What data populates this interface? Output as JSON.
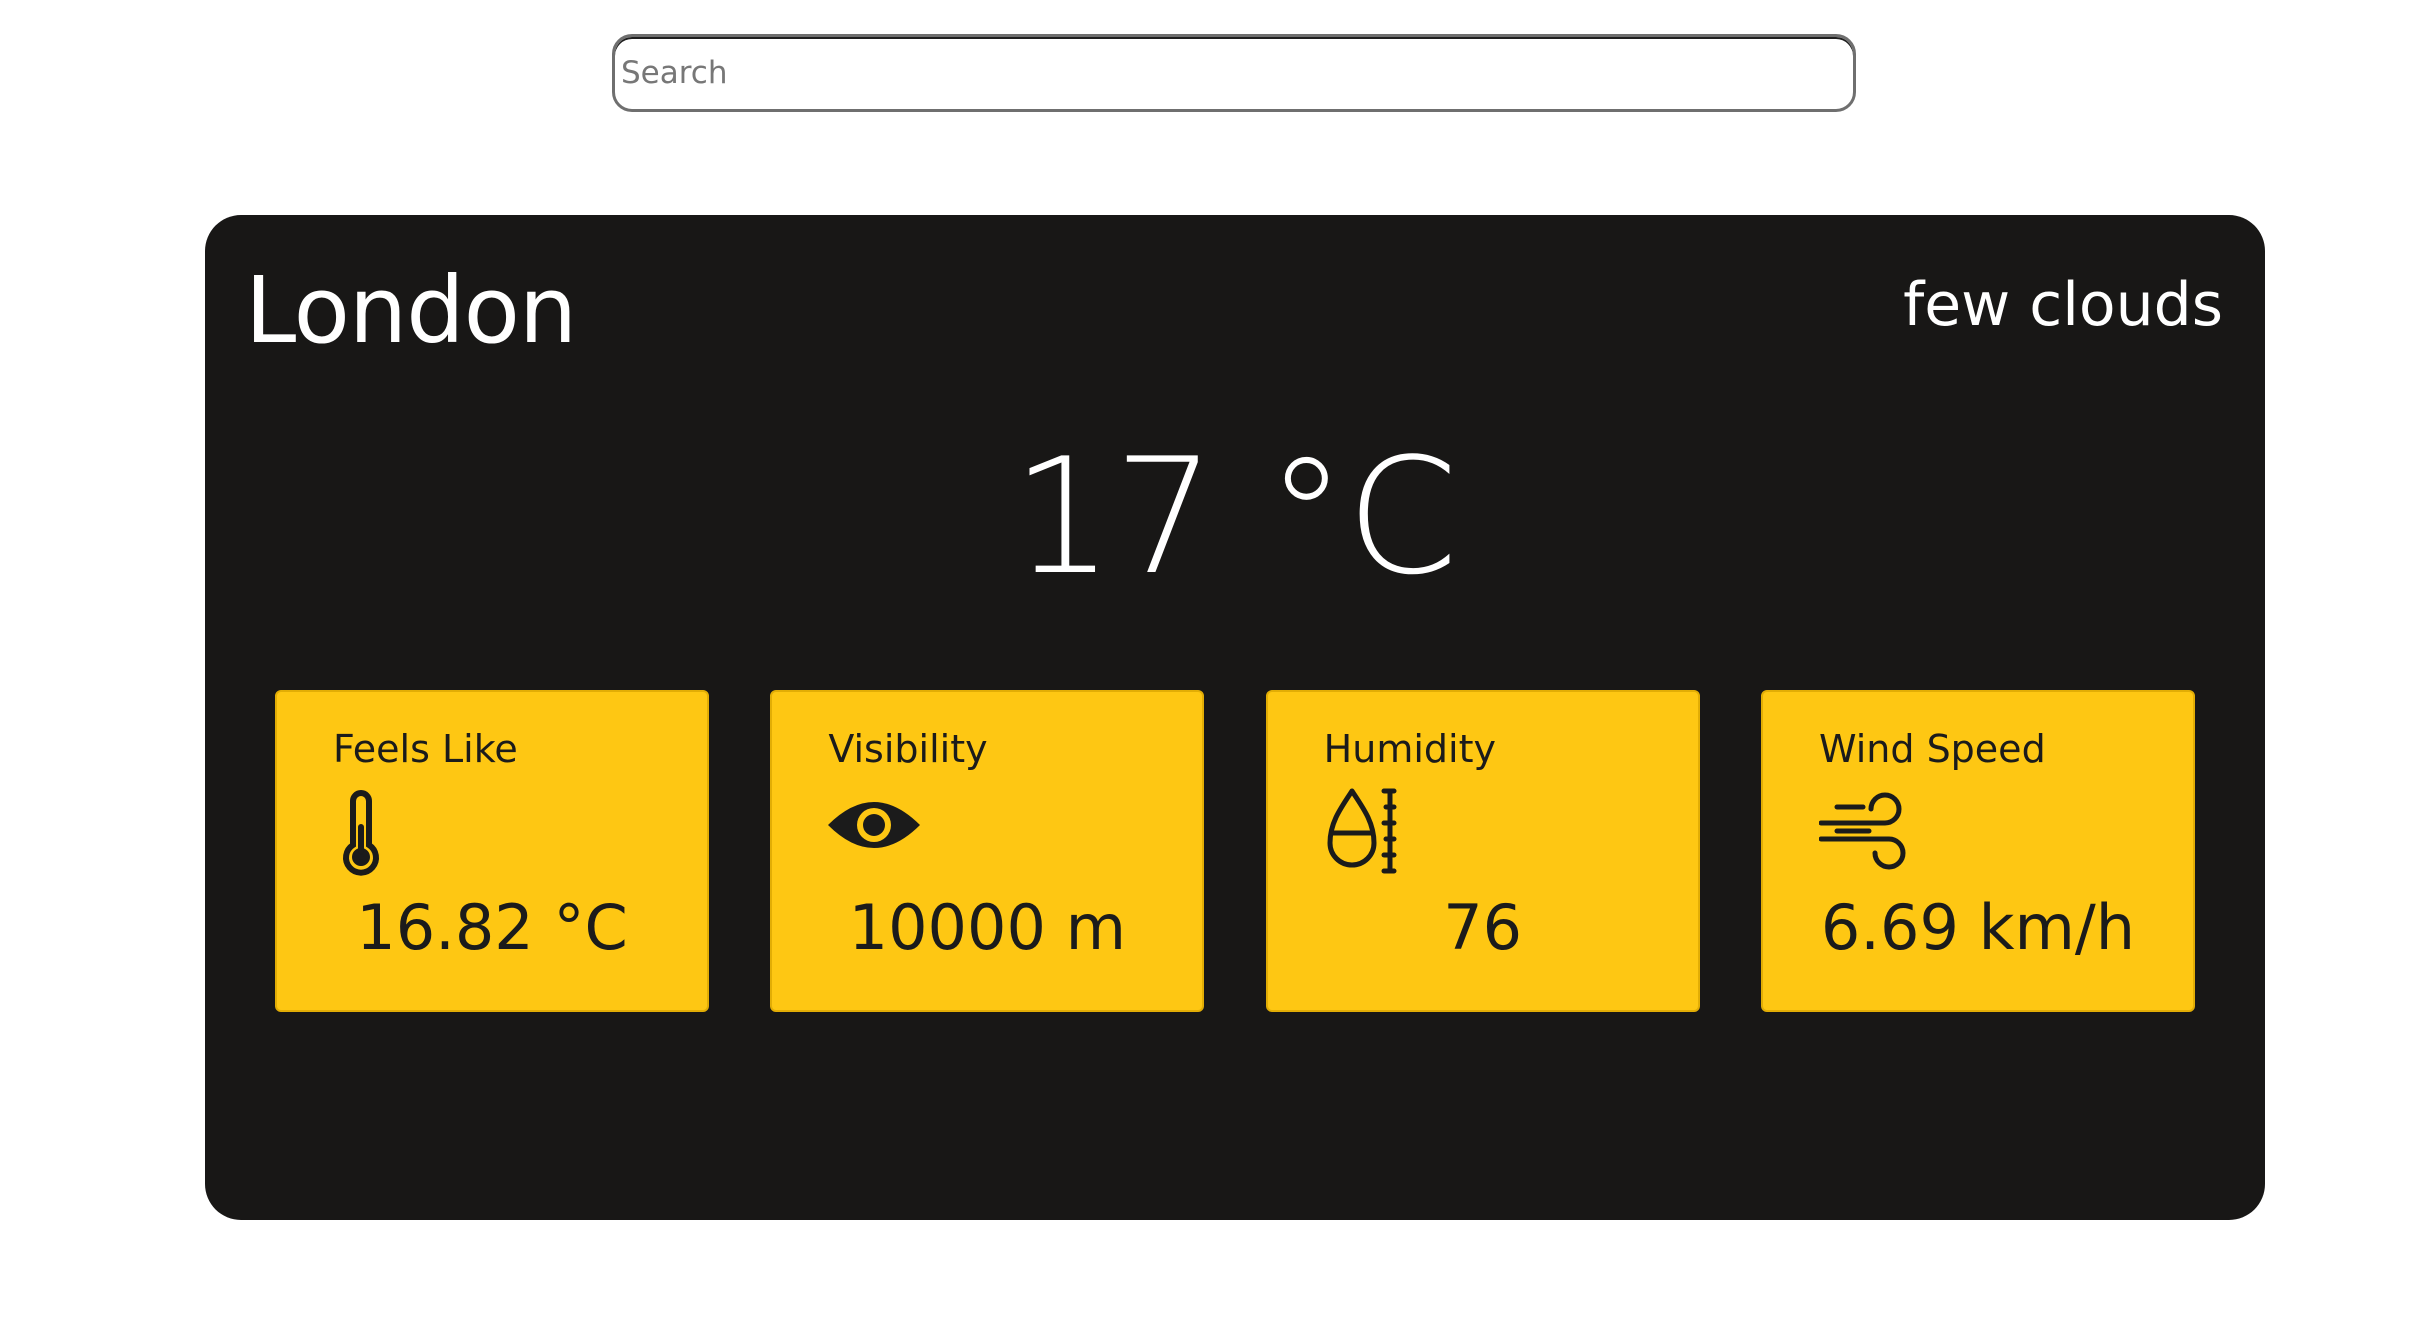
{
  "search": {
    "placeholder": "Search",
    "value": ""
  },
  "weather": {
    "city": "London",
    "description": "few clouds",
    "temperature": "17 °C"
  },
  "tiles": [
    {
      "label": "Feels Like",
      "icon": "thermometer-icon",
      "value": "16.82 °C"
    },
    {
      "label": "Visibility",
      "icon": "eye-icon",
      "value": "10000 m"
    },
    {
      "label": "Humidity",
      "icon": "humidity-icon",
      "value": "76"
    },
    {
      "label": "Wind Speed",
      "icon": "wind-icon",
      "value": "6.69 km/h"
    }
  ],
  "colors": {
    "card_background": "#181716",
    "tile_background": "#fec713",
    "text_light": "#ffffff",
    "text_dark": "#1b1b1b"
  }
}
